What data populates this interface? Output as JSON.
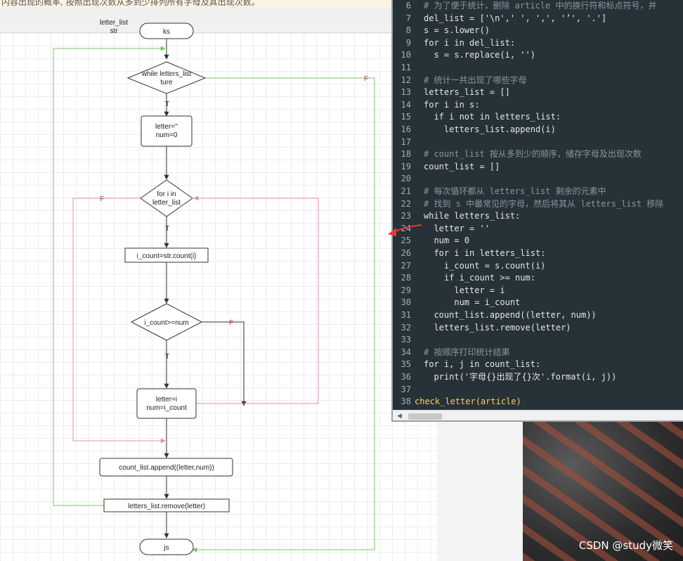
{
  "top_banner": {
    "text": "内容出现的概率, 按照出现次数从多到少排列所有字母及其出现次数。"
  },
  "flowchart": {
    "inputs_label_1": "letter_list",
    "inputs_label_2": "str",
    "start": "ks",
    "while_line1": "while letters_list",
    "while_line2": "ture",
    "init_line1": "letter=''",
    "init_line2": "num=0",
    "for_line1": "for i in",
    "for_line2": "letter_list",
    "count": "i_count=str.count(i)",
    "if_cond": "i_count>=num",
    "assign_line1": "letter=i",
    "assign_line2": "num=i_count",
    "append": "count_list.append((letter,num))",
    "remove": "letters_list.remove(letter)",
    "end": "js",
    "true_label": "T",
    "false_label": "F"
  },
  "code_lines": [
    {
      "n": "6",
      "text": "# 为了便于统计，删除 article 中的换行符和标点符号，并"
    },
    {
      "n": "7",
      "text": "del_list = ['\\n',' ', ',', '’', '.']"
    },
    {
      "n": "8",
      "text": "s = s.lower()"
    },
    {
      "n": "9",
      "text": "for i in del_list:"
    },
    {
      "n": "10",
      "text": "  s = s.replace(i, '')"
    },
    {
      "n": "11",
      "text": ""
    },
    {
      "n": "12",
      "text": "# 统计一共出现了哪些字母"
    },
    {
      "n": "13",
      "text": "letters_list = []"
    },
    {
      "n": "14",
      "text": "for i in s:"
    },
    {
      "n": "15",
      "text": "  if i not in letters_list:"
    },
    {
      "n": "16",
      "text": "    letters_list.append(i)"
    },
    {
      "n": "17",
      "text": ""
    },
    {
      "n": "18",
      "text": "# count_list 按从多到少的顺序，储存字母及出现次数"
    },
    {
      "n": "19",
      "text": "count_list = []"
    },
    {
      "n": "20",
      "text": ""
    },
    {
      "n": "21",
      "text": "# 每次循环都从 letters_list 剩余的元素中"
    },
    {
      "n": "22",
      "text": "# 找到 s 中最常见的字母，然后将其从 letters_list 移除"
    },
    {
      "n": "23",
      "text": "while letters_list:"
    },
    {
      "n": "24",
      "text": "  letter = ''"
    },
    {
      "n": "25",
      "text": "  num = 0"
    },
    {
      "n": "26",
      "text": "  for i in letters_list:"
    },
    {
      "n": "27",
      "text": "    i_count = s.count(i)"
    },
    {
      "n": "28",
      "text": "    if i_count >= num:"
    },
    {
      "n": "29",
      "text": "      letter = i"
    },
    {
      "n": "30",
      "text": "      num = i_count"
    },
    {
      "n": "31",
      "text": "  count_list.append((letter, num))"
    },
    {
      "n": "32",
      "text": "  letters_list.remove(letter)"
    },
    {
      "n": "33",
      "text": ""
    },
    {
      "n": "34",
      "text": "# 按顺序打印统计结果"
    },
    {
      "n": "35",
      "text": "for i, j in count_list:"
    },
    {
      "n": "36",
      "text": "  print('字母{}出现了{}次'.format(i, j))"
    },
    {
      "n": "37",
      "text": ""
    },
    {
      "n": "38",
      "text": "check_letter(article)"
    }
  ],
  "watermark": "CSDN @study微笑",
  "colors": {
    "editor_bg": "#263238",
    "flow_true_arrow": "#7cc26a",
    "flow_false_arrow": "#e58cc0",
    "annotation_arrow": "#e53935"
  },
  "icons": {
    "scroll_left": "triangle-left-icon"
  }
}
